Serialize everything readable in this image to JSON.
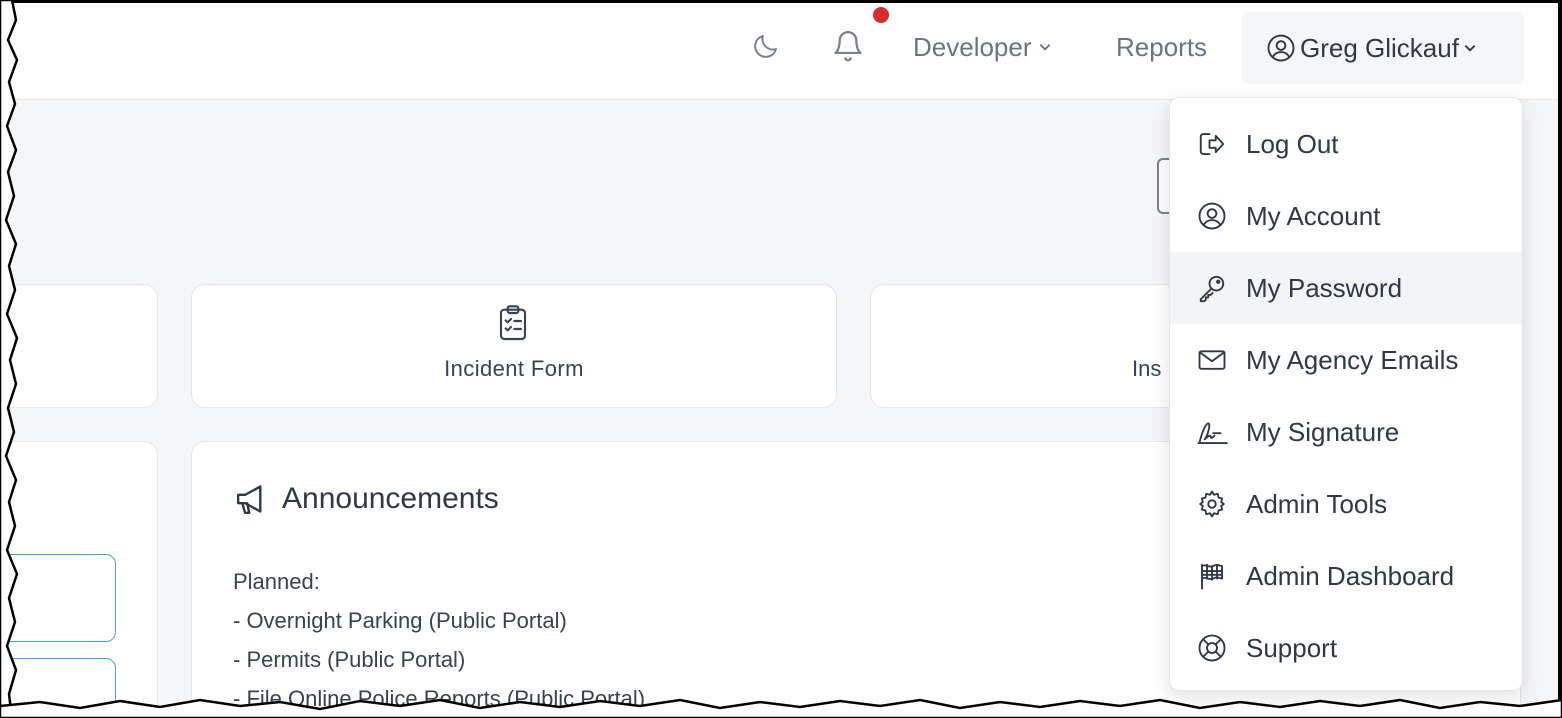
{
  "topbar": {
    "theme_icon": "moon-icon",
    "notifications_icon": "bell-icon",
    "notification_dot_color": "#d62c2c",
    "developer_label": "Developer",
    "reports_label": "Reports",
    "user_name": "Greg Glickauf"
  },
  "cards": {
    "incident_form_label": "Incident Form",
    "ins_partial_label": "Ins"
  },
  "announcements": {
    "title": "Announcements",
    "lines": [
      "Planned:",
      "- Overnight Parking (Public Portal)",
      "- Permits (Public Portal)",
      "- File Online Police Reports (Public Portal)"
    ]
  },
  "user_menu": {
    "items": [
      {
        "label": "Log Out",
        "icon": "log-out-icon"
      },
      {
        "label": "My Account",
        "icon": "user-circle-icon"
      },
      {
        "label": "My Password",
        "icon": "key-icon"
      },
      {
        "label": "My Agency Emails",
        "icon": "envelope-icon"
      },
      {
        "label": "My Signature",
        "icon": "signature-icon"
      },
      {
        "label": "Admin Tools",
        "icon": "gear-icon"
      },
      {
        "label": "Admin Dashboard",
        "icon": "flag-icon"
      },
      {
        "label": "Support",
        "icon": "life-ring-icon"
      }
    ]
  },
  "colors": {
    "accent_blue": "#4a9fe0",
    "text": "#2f3846",
    "muted": "#6c7480"
  }
}
